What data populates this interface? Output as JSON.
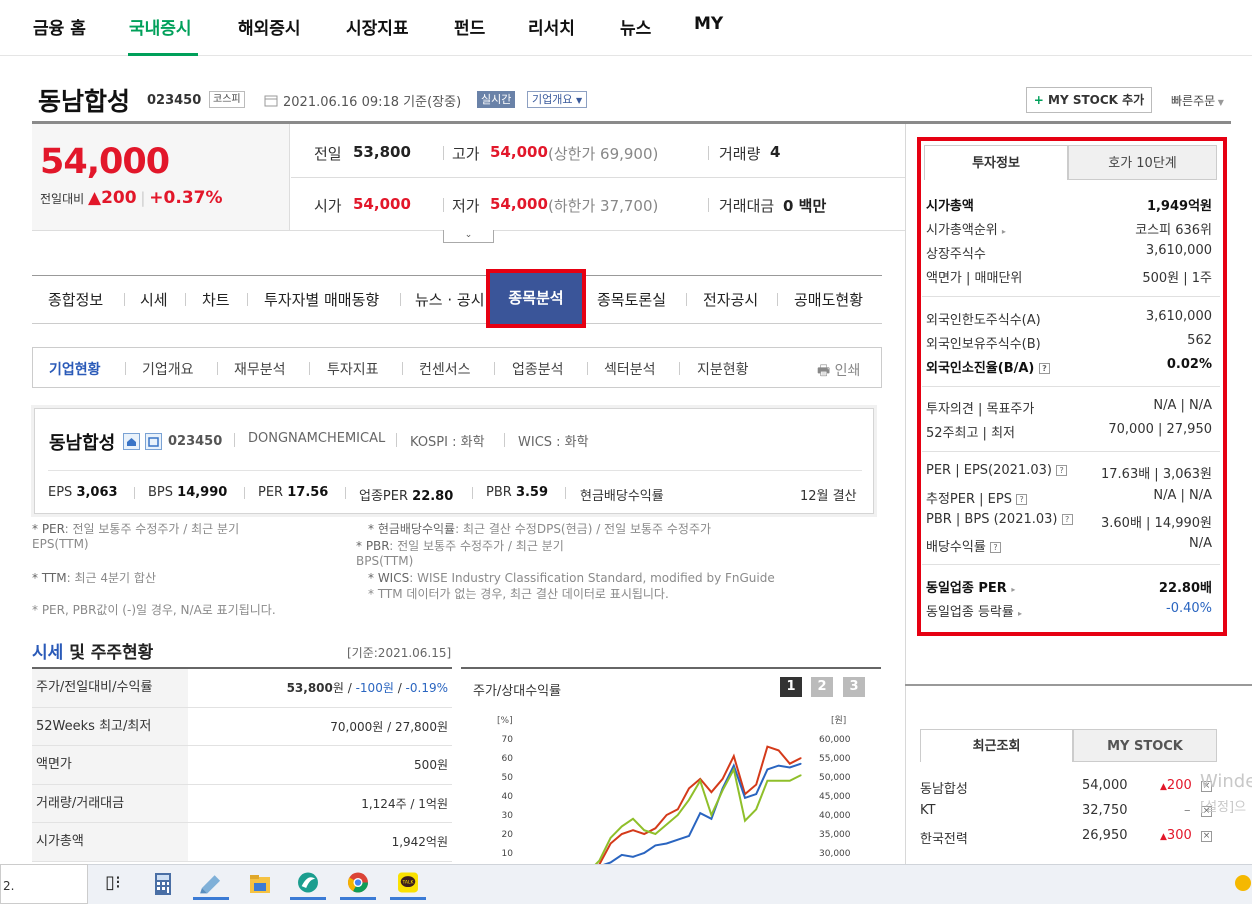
{
  "topnav": {
    "items": [
      "금융 홈",
      "국내증시",
      "해외증시",
      "시장지표",
      "펀드",
      "리서치",
      "뉴스",
      "MY"
    ],
    "active": "국내증시"
  },
  "header": {
    "name": "동남합성",
    "code": "023450",
    "market": "코스피",
    "date": "2021.06.16 09:18 기준(장중)",
    "realtime": "실시간",
    "corp_info": "기업개요",
    "mystock_btn": "MY STOCK 추가",
    "quick_order": "빠른주문"
  },
  "price": {
    "current": "54,000",
    "change_label": "전일대비",
    "change": "200",
    "change_pct": "+0.37%"
  },
  "summary": {
    "prev_label": "전일",
    "prev": "53,800",
    "high_label": "고가",
    "high": "54,000",
    "high_limit": "(상한가 69,900)",
    "vol_label": "거래량",
    "vol": "4",
    "open_label": "시가",
    "open": "54,000",
    "low_label": "저가",
    "low": "54,000",
    "low_limit": "(하한가 37,700)",
    "amt_label": "거래대금",
    "amt": "0 백만"
  },
  "tabs1": [
    "종합정보",
    "시세",
    "차트",
    "투자자별 매매동향",
    "뉴스 · 공시",
    "종목분석",
    "종목토론실",
    "전자공시",
    "공매도현황"
  ],
  "tabs1_active": "종목분석",
  "tabs2": [
    "기업현황",
    "기업개요",
    "재무분석",
    "투자지표",
    "컨센서스",
    "업종분석",
    "섹터분석",
    "지분현황"
  ],
  "print_label": "인쇄",
  "infobox": {
    "name": "동남합성",
    "code": "023450",
    "eng": "DONGNAMCHEMICAL",
    "kospi": "KOSPI : 화학",
    "wics": "WICS : 화학",
    "eps_l": "EPS",
    "eps": "3,063",
    "bps_l": "BPS",
    "bps": "14,990",
    "per_l": "PER",
    "per": "17.56",
    "iper_l": "업종PER",
    "iper": "22.80",
    "pbr_l": "PBR",
    "pbr": "3.59",
    "div_l": "현금배당수익률",
    "settle": "12월 결산"
  },
  "notes": {
    "n1a": "* PER",
    "n1b": ": 전일 보통주 수정주가 / 최근 분기",
    "n1c": "EPS(TTM)",
    "n2a": "* 현금배당수익률",
    "n2b": ": 최근 결산 수정DPS(현금) / 전일 보통주 수정주가",
    "n3a": "* PBR",
    "n3b": ": 전일 보통주 수정주가 / 최근 분기",
    "n3c": "BPS(TTM)",
    "n4a": "* TTM",
    "n4b": ": 최근 4분기 합산",
    "n5a": "* WICS",
    "n5b": ": WISE Industry Classification Standard, modified by FnGuide",
    "n6": "* TTM 데이터가 없는 경우, 최근 결산 데이터로 표시됩니다.",
    "n7": "* PER, PBR값이 (-)일 경우, N/A로 표기됩니다."
  },
  "section": {
    "title_a": "시세",
    "title_b": " 및 주주현황",
    "basis": "[기준:2021.06.15]"
  },
  "price_table": [
    {
      "k": "주가/전일대비/수익률",
      "v1": "53,800",
      "v1u": "원",
      "v2": "-100원",
      "v3": "-0.19%"
    },
    {
      "k": "52Weeks 최고/최저",
      "v": "70,000원 / 27,800원"
    },
    {
      "k": "액면가",
      "v": "500원"
    },
    {
      "k": "거래량/거래대금",
      "v": "1,124주 / 1억원"
    },
    {
      "k": "시가총액",
      "v": "1,942억원"
    }
  ],
  "chart_panel": {
    "title": "주가/상대수익률",
    "btns": [
      "1",
      "2",
      "3"
    ]
  },
  "chart_data": {
    "type": "line",
    "ylabel_left": "[%]",
    "ylabel_right": "[원]",
    "y_left_ticks": [
      "70",
      "60",
      "50",
      "40",
      "30",
      "20",
      "10"
    ],
    "y_right_ticks": [
      "60,000",
      "55,000",
      "50,000",
      "45,000",
      "40,000",
      "35,000",
      "30,000"
    ],
    "ylim_left": [
      0,
      70
    ],
    "x": [
      0,
      1,
      2,
      3,
      4,
      5,
      6,
      7,
      8,
      9,
      10,
      11,
      12,
      13,
      14,
      15,
      16,
      17,
      18,
      19,
      20,
      21,
      22,
      23,
      24,
      25
    ],
    "series": [
      {
        "color": "#d43a1a",
        "values": [
          0,
          0,
          -1,
          0,
          1,
          0,
          0,
          4,
          15,
          20,
          22,
          20,
          23,
          30,
          33,
          44,
          49,
          42,
          49,
          61,
          41,
          46,
          66,
          64,
          57,
          60
        ]
      },
      {
        "color": "#2a65c0",
        "values": [
          0,
          0,
          -1,
          0,
          0,
          0,
          0,
          3,
          5,
          9,
          8,
          10,
          14,
          15,
          17,
          19,
          31,
          28,
          44,
          56,
          39,
          41,
          54,
          56,
          55,
          57
        ]
      },
      {
        "color": "#8fbf2a",
        "values": [
          0,
          -1,
          -2,
          0,
          0,
          0,
          0,
          6,
          18,
          24,
          28,
          22,
          20,
          25,
          30,
          38,
          48,
          30,
          43,
          54,
          27,
          33,
          48,
          48,
          48,
          51
        ]
      }
    ]
  },
  "side": {
    "tab_invest": "투자정보",
    "tab_hoga": "호가 10단계",
    "rows": [
      {
        "k": "시가총액",
        "v": "1,949억원",
        "bold": true
      },
      {
        "k": "시가총액순위",
        "v": "코스피 636위"
      },
      {
        "k": "상장주식수",
        "v": "3,610,000"
      },
      {
        "k": "액면가 | 매매단위",
        "v": "500원 | 1주"
      },
      {
        "k": "외국인한도주식수(A)",
        "v": "3,610,000"
      },
      {
        "k": "외국인보유주식수(B)",
        "v": "562"
      },
      {
        "k": "외국인소진율(B/A)",
        "v": "0.02%",
        "bold": true
      },
      {
        "k": "투자의견 | 목표주가",
        "v": "N/A | N/A"
      },
      {
        "k": "52주최고 | 최저",
        "v": "70,000 | 27,950"
      },
      {
        "k": "PER | EPS(2021.03)",
        "v": "17.63배 | 3,063원"
      },
      {
        "k": "추정PER | EPS",
        "v": "N/A | N/A"
      },
      {
        "k": "PBR | BPS (2021.03)",
        "v": "3.60배 | 14,990원"
      },
      {
        "k": "배당수익률",
        "v": "N/A"
      },
      {
        "k": "동일업종 PER",
        "v": "22.80배",
        "bold": true
      },
      {
        "k": "동일업종 등락률",
        "v": "-0.40%"
      }
    ]
  },
  "recent": {
    "tab_recent": "최근조회",
    "tab_my": "MY STOCK",
    "rows": [
      {
        "name": "동남합성",
        "price": "54,000",
        "chg": "200",
        "dir": "up"
      },
      {
        "name": "KT",
        "price": "32,750",
        "chg": "",
        "dir": "flat"
      },
      {
        "name": "한국전력",
        "price": "26,950",
        "chg": "300",
        "dir": "up"
      }
    ]
  },
  "taskbar": {
    "search": "2."
  },
  "watermark": {
    "l1": "Winde",
    "l2": "[설정]으"
  }
}
